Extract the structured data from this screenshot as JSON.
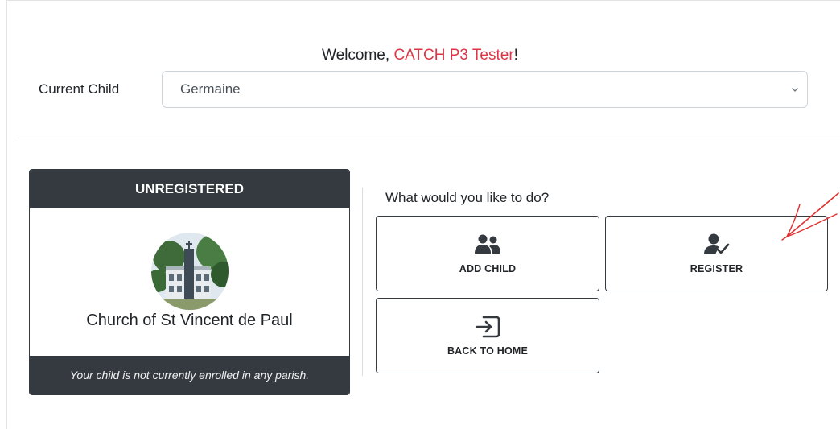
{
  "header": {
    "welcome_prefix": "Welcome, ",
    "user_name": "CATCH P3 Tester",
    "welcome_suffix": "!"
  },
  "child_selector": {
    "label": "Current Child",
    "selected": "Germaine"
  },
  "parish_card": {
    "status": "UNREGISTERED",
    "church_name": "Church of St Vincent de Paul",
    "footer_note": "Your child is not currently enrolled in any parish."
  },
  "actions": {
    "prompt": "What would you like to do?",
    "add_child": "ADD CHILD",
    "register": "REGISTER",
    "back_to_home": "BACK TO HOME"
  },
  "icons": {
    "add_child": "users-icon",
    "register": "user-check-icon",
    "back_to_home": "sign-in-icon",
    "select": "chevron-down-icon",
    "annotation": "red-arrow-annotation"
  },
  "colors": {
    "accent": "#dc3545",
    "dark": "#343a40",
    "annotation": "#e03030"
  }
}
